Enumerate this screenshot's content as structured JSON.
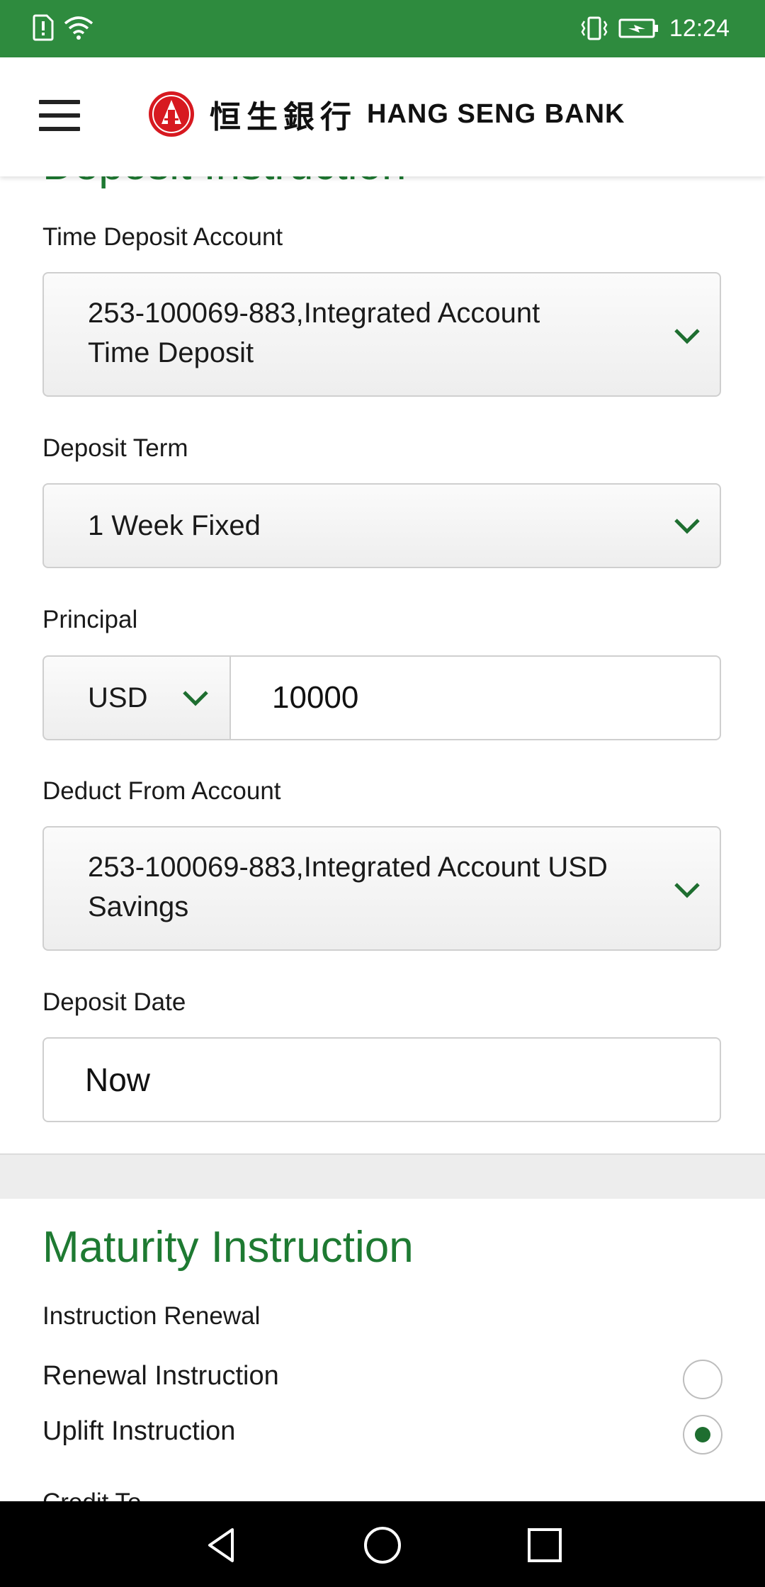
{
  "status_bar": {
    "time": "12:24",
    "icons": [
      "sim-alert-icon",
      "wifi-icon",
      "vibrate-icon",
      "battery-charging-icon"
    ]
  },
  "header": {
    "menu_icon": "hamburger-menu-icon",
    "logo_chinese": "恒生銀行",
    "logo_english": "HANG SENG BANK"
  },
  "deposit": {
    "section_title": "Deposit Instruction",
    "time_deposit_account": {
      "label": "Time Deposit Account",
      "line1": "253-100069-883,Integrated Account",
      "line2": "Time Deposit"
    },
    "deposit_term": {
      "label": "Deposit Term",
      "value": "1 Week Fixed"
    },
    "principal": {
      "label": "Principal",
      "currency": "USD",
      "amount": "10000"
    },
    "deduct_from_account": {
      "label": "Deduct From Account",
      "line1": "253-100069-883,Integrated Account USD",
      "line2": "Savings"
    },
    "deposit_date": {
      "label": "Deposit Date",
      "value": "Now"
    }
  },
  "maturity": {
    "section_title": "Maturity Instruction",
    "renewal_label": "Instruction Renewal",
    "options": [
      {
        "label": "Renewal Instruction",
        "selected": false
      },
      {
        "label": "Uplift Instruction",
        "selected": true
      }
    ],
    "next_label": "Credit To"
  },
  "colors": {
    "status_bar": "#2e8b3e",
    "accent": "#1e7a32",
    "logo_red": "#d71920"
  },
  "nav_bar": [
    "back-icon",
    "home-icon",
    "recents-icon"
  ]
}
